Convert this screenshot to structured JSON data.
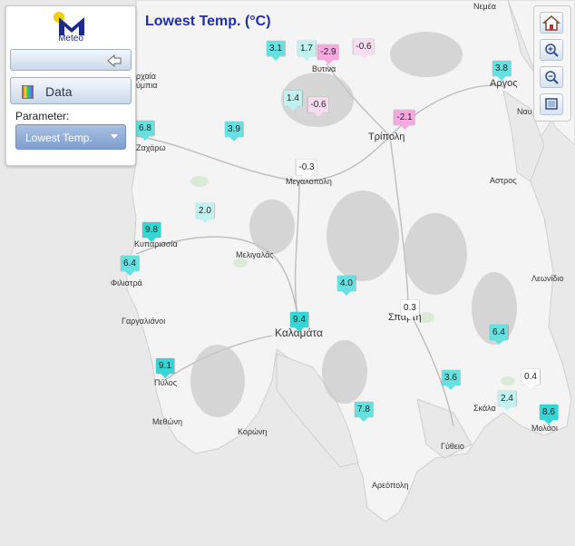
{
  "logo": {
    "text": "Meteo"
  },
  "sidebar": {
    "data_button": "Data",
    "parameter_label": "Parameter:",
    "parameter_value": "Lowest Temp."
  },
  "map_title": "Lowest Temp. (°C)",
  "colors": {
    "title": "#1f2fa8",
    "cyan_marker": "#66e0e0",
    "light_cyan_marker": "#bff2f0",
    "white_marker": "#ffffff",
    "pink_marker": "#f6a9e0",
    "light_pink_marker": "#f7dcef",
    "sea": "#e9e9e9",
    "land": "#f4f4f4"
  },
  "controls": [
    "home-icon",
    "zoom-in-icon",
    "zoom-out-icon",
    "fit-extent-icon"
  ],
  "towns": [
    {
      "name": "Νεμέα",
      "key": "nemea"
    },
    {
      "name": "Αργος",
      "key": "argos"
    },
    {
      "name": "Ναυ",
      "key": "nafplio"
    },
    {
      "name": "Βυτινα",
      "key": "vytina"
    },
    {
      "name": "Τρίπολη",
      "key": "tripoli"
    },
    {
      "name": "Μεγαλοπολη",
      "key": "megalopoli"
    },
    {
      "name": "Αστρος",
      "key": "astros"
    },
    {
      "name": "Ζαχάρω",
      "key": "zacharo"
    },
    {
      "name": "ρχαία",
      "key": "archaia"
    },
    {
      "name": "ύμπια",
      "key": "olympia"
    },
    {
      "name": "Κυπαρισσία",
      "key": "kyparissia"
    },
    {
      "name": "Μελιγαλάς",
      "key": "meligalas"
    },
    {
      "name": "Φιλιατρά",
      "key": "filiatra"
    },
    {
      "name": "Λεωνίδιο",
      "key": "leonidio"
    },
    {
      "name": "Γαργαλιάνοι",
      "key": "gargalianoi"
    },
    {
      "name": "Σπάρτη",
      "key": "sparti"
    },
    {
      "name": "Καλαμάτα",
      "key": "kalamata"
    },
    {
      "name": "Πύλος",
      "key": "pylos"
    },
    {
      "name": "Σκάλα",
      "key": "skala"
    },
    {
      "name": "Μολάοι",
      "key": "molaoi"
    },
    {
      "name": "Μεθώνη",
      "key": "methoni"
    },
    {
      "name": "Κορώνη",
      "key": "koroni"
    },
    {
      "name": "Γύθειο",
      "key": "gytheio"
    },
    {
      "name": "Αρεόπολη",
      "key": "areopoli"
    }
  ],
  "markers": [
    {
      "value": "3.1",
      "color": "#66e0e0"
    },
    {
      "value": "1.7",
      "color": "#bff2f0"
    },
    {
      "value": "-2.9",
      "color": "#f6a9e0"
    },
    {
      "value": "-0.6",
      "color": "#f7dcef"
    },
    {
      "value": "3.8",
      "color": "#66e0e0"
    },
    {
      "value": "1.4",
      "color": "#bff2f0"
    },
    {
      "value": "-0.6",
      "color": "#f7dcef"
    },
    {
      "value": "-2.1",
      "color": "#f6a9e0"
    },
    {
      "value": "6.8",
      "color": "#66e0e0"
    },
    {
      "value": "3.9",
      "color": "#66e0e0"
    },
    {
      "value": "-0.3",
      "color": "#ffffff"
    },
    {
      "value": "2.0",
      "color": "#bff2f0"
    },
    {
      "value": "9.8",
      "color": "#35d6d6"
    },
    {
      "value": "6.4",
      "color": "#66e0e0"
    },
    {
      "value": "4.0",
      "color": "#66e0e0"
    },
    {
      "value": "0.3",
      "color": "#ffffff"
    },
    {
      "value": "9.4",
      "color": "#35d6d6"
    },
    {
      "value": "6.4",
      "color": "#66e0e0"
    },
    {
      "value": "9.1",
      "color": "#35d6d6"
    },
    {
      "value": "3.6",
      "color": "#66e0e0"
    },
    {
      "value": "0.4",
      "color": "#ffffff"
    },
    {
      "value": "2.4",
      "color": "#bff2f0"
    },
    {
      "value": "7.8",
      "color": "#66e0e0"
    },
    {
      "value": "8.6",
      "color": "#35d6d6"
    }
  ]
}
